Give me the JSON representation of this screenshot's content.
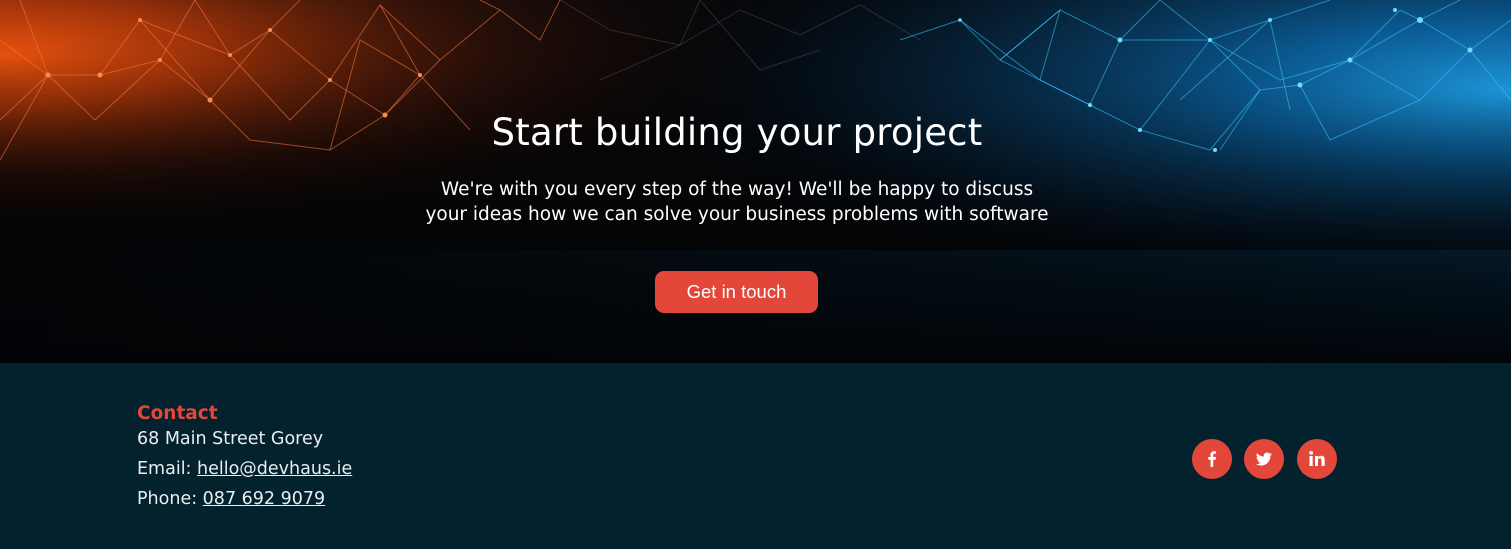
{
  "hero": {
    "title": "Start building your project",
    "subtitle_line1": "We're with you every step of the way! We'll be happy to discuss",
    "subtitle_line2": "your ideas how we can solve your business problems with software",
    "cta_label": "Get in touch"
  },
  "footer": {
    "contact": {
      "heading": "Contact",
      "address": "68 Main Street Gorey",
      "email_label": "Email: ",
      "email": "hello@devhaus.ie",
      "phone_label": "Phone: ",
      "phone": "087 692 9079"
    },
    "social": [
      {
        "icon": "facebook-icon"
      },
      {
        "icon": "twitter-icon"
      },
      {
        "icon": "linkedin-icon"
      }
    ]
  },
  "colors": {
    "accent": "#e2473a",
    "footer_bg": "#04212e",
    "hero_left": "#e0521a",
    "hero_right": "#1aa0ff"
  }
}
